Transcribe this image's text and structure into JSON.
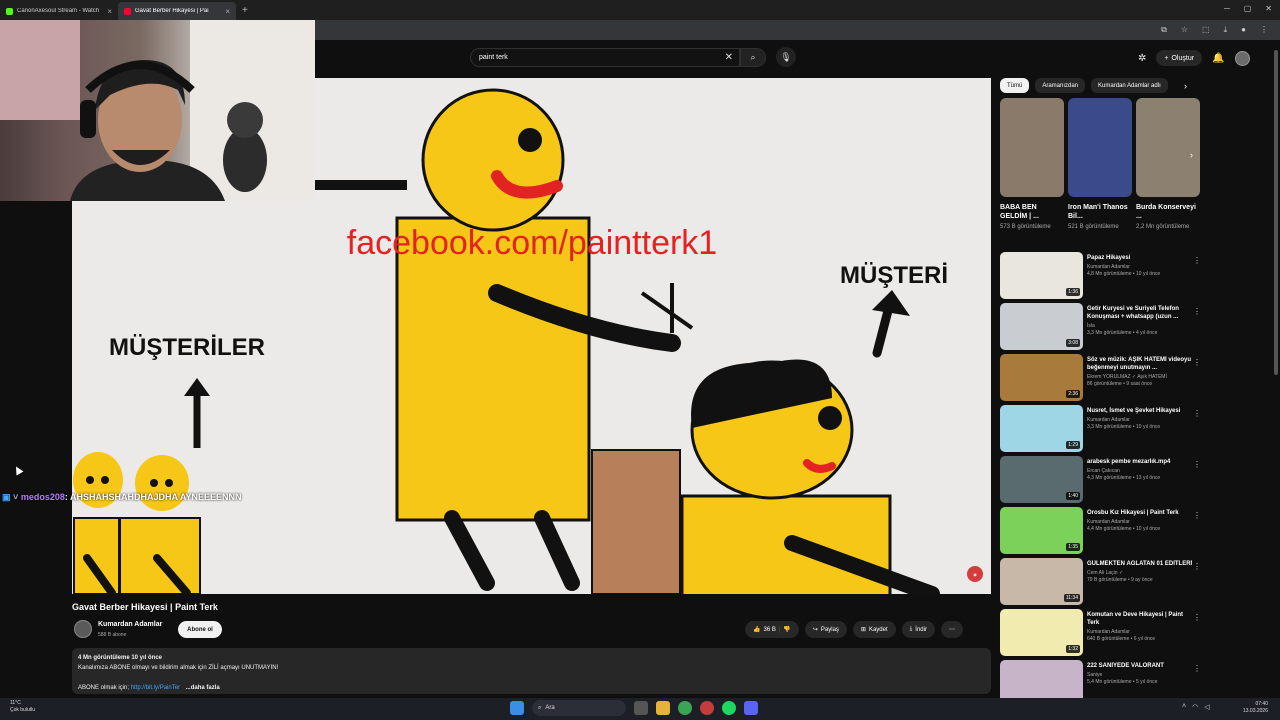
{
  "browser": {
    "tabs": [
      {
        "title": "CanonAxesoul Stream - Watch",
        "favicon_color": "#53fc18"
      },
      {
        "title": "Gavat Berber Hikayesi | Pai",
        "favicon_color": "#ff0033"
      }
    ],
    "new_tab": "+"
  },
  "header": {
    "search_query": "paint terk",
    "create_label": "Oluştur"
  },
  "video": {
    "overlay": {
      "facebook": "facebook.com/paintterk1",
      "label_left": "MÜŞTERİLER",
      "label_right": "MÜŞTERİ"
    },
    "title": "Gavat Berber Hikayesi | Paint Terk",
    "channel": "Kumardan Adamlar",
    "subscribers": "588 B abone",
    "subscribe_label": "Abone ol",
    "likes": "36 B",
    "share_label": "Paylaş",
    "save_label": "Kaydet",
    "download_label": "İndir",
    "description": {
      "views_line": "4 Mn görüntüleme  10 yıl önce",
      "line1": "Kanalımıza ABONE olmayı ve bildirim almak için ZİLİ açmayı UNUTMAYIN!",
      "line2_prefix": "ABONE olmak için; ",
      "link": "http://bit.ly/PainTer",
      "more": "...daha fazla"
    }
  },
  "chat": {
    "user": "medos208",
    "message": ": AHSHAHSHAHDHAJDHA AYNEEEENNN"
  },
  "chips": [
    "Tümü",
    "Aramanızdan",
    "Kumardan Adamlar adlı"
  ],
  "shorts": [
    {
      "title": "BABA BEN GELDİM | ...",
      "views": "573 B görüntüleme",
      "thumb": "#8a7a6a"
    },
    {
      "title": "Iron Man'i Thanos Bil...",
      "views": "521 B görüntüleme",
      "thumb": "#3a4a8a"
    },
    {
      "title": "Burda Konserveyi ...",
      "views": "2,2 Mn görüntüleme",
      "thumb": "#8c8070"
    }
  ],
  "recommendations": [
    {
      "title": "Papaz Hikayesi",
      "channel": "Kumardan Adamlar",
      "meta": "4,8 Mn görüntüleme • 10 yıl önce",
      "duration": "1:36",
      "thumb": "#e8e6df"
    },
    {
      "title": "Getir Kuryesi ve Suriyeli Telefon Konuşması + whatsapp (uzun ...",
      "channel": "İsla",
      "meta": "3,3 Mn görüntüleme • 4 yıl önce",
      "duration": "3:08",
      "thumb": "#c9cdd2"
    },
    {
      "title": "Söz ve müzik: AŞIK HATEMİ videoyu beğenmeyi unutmayın ...",
      "channel": "Ekrem YORULMAZ ✓ Aşık HATEMİ",
      "meta": "86 görüntüleme • 9 saat önce",
      "duration": "2:36",
      "thumb": "#a87a3c"
    },
    {
      "title": "Nusret, İsmet ve Şevket Hikayesi",
      "channel": "Kumardan Adamlar",
      "meta": "3,3 Mn görüntüleme • 10 yıl önce",
      "duration": "1:29",
      "thumb": "#9fd6e6"
    },
    {
      "title": "arabesk pembe mezarlık.mp4",
      "channel": "Ercan Çakıcan",
      "meta": "4,3 Mn görüntüleme • 13 yıl önce",
      "duration": "1:40",
      "thumb": "#5a6b70"
    },
    {
      "title": "Orosbu Kız Hikayesi | Paint Terk",
      "channel": "Kumardan Adamlar",
      "meta": "4,4 Mn görüntüleme • 10 yıl önce",
      "duration": "1:35",
      "thumb": "#7bd15a"
    },
    {
      "title": "GÜLMEKTEN AĞLATAN 01 EDİTLERİ",
      "channel": "Cem Ali Laçin ✓",
      "meta": "79 B görüntüleme • 9 ay önce",
      "duration": "11:34",
      "thumb": "#c7b8a8"
    },
    {
      "title": "Komutan ve Deve Hikayesi | Paint Terk",
      "channel": "Kumardan Adamlar",
      "meta": "640 B görüntüleme • 6 yıl önce",
      "duration": "1:32",
      "thumb": "#f1ebb0"
    },
    {
      "title": "222 SANİYEDE VALORANT",
      "channel": "Saniye",
      "meta": "5,4 Mn görüntüleme • 5 yıl önce",
      "duration": "",
      "thumb": "#c8b4c8"
    }
  ],
  "taskbar": {
    "weather_temp": "11°C",
    "weather_desc": "Çok bulutlu",
    "search_label": "Ara",
    "time": "07:40",
    "date": "13.03.2026"
  }
}
